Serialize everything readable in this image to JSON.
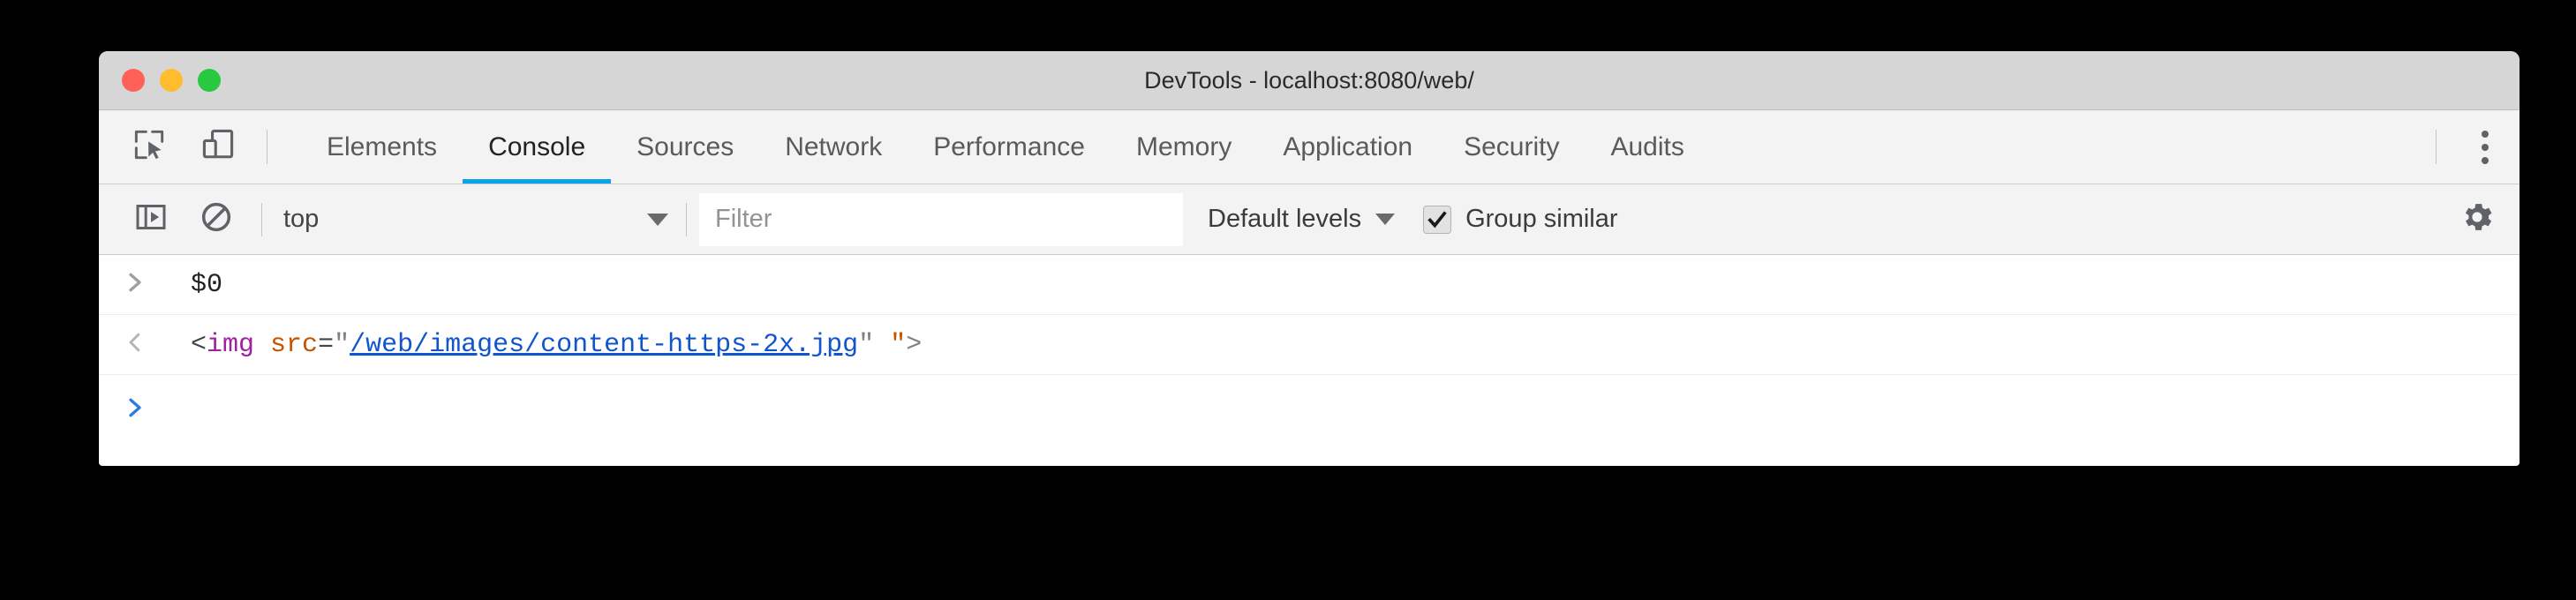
{
  "window": {
    "title": "DevTools - localhost:8080/web/",
    "traffic_lights": [
      {
        "name": "close",
        "color": "#ff6159"
      },
      {
        "name": "minimize",
        "color": "#ffbd2e"
      },
      {
        "name": "maximize",
        "color": "#28c840"
      }
    ]
  },
  "tabbar": {
    "inspect_icon": "inspect-element-icon",
    "device_icon": "device-toolbar-icon",
    "tabs": [
      {
        "label": "Elements",
        "active": false
      },
      {
        "label": "Console",
        "active": true
      },
      {
        "label": "Sources",
        "active": false
      },
      {
        "label": "Network",
        "active": false
      },
      {
        "label": "Performance",
        "active": false
      },
      {
        "label": "Memory",
        "active": false
      },
      {
        "label": "Application",
        "active": false
      },
      {
        "label": "Security",
        "active": false
      },
      {
        "label": "Audits",
        "active": false
      }
    ],
    "more_icon": "kebab-menu-icon",
    "active_underline_color": "#0aa5e8"
  },
  "console_toolbar": {
    "sidebar_toggle_icon": "console-sidebar-icon",
    "clear_icon": "clear-console-icon",
    "context": {
      "value": "top",
      "caret": "chevron-down-icon"
    },
    "filter": {
      "value": "",
      "placeholder": "Filter"
    },
    "levels": {
      "value": "Default levels",
      "caret": "chevron-down-icon"
    },
    "group_similar": {
      "label": "Group similar",
      "checked": true,
      "check_glyph": "✔"
    },
    "settings_icon": "gear-icon"
  },
  "console": {
    "rows": [
      {
        "type": "input",
        "gutter_icon": "prompt-arrow-icon",
        "text": "$0"
      },
      {
        "type": "output",
        "gutter_icon": "result-arrow-icon",
        "tokens": {
          "open_bracket": "<",
          "tag": "img",
          "space": " ",
          "attr": "src",
          "equals": "=",
          "quote_open": "\"",
          "url": "/web/images/content-https-2x.jpg",
          "quote_close": "\"",
          "gap": " ",
          "quote_extra": "\"",
          "close_bracket": ">"
        }
      },
      {
        "type": "prompt",
        "gutter_icon": "prompt-arrow-active-icon",
        "text": ""
      }
    ]
  }
}
